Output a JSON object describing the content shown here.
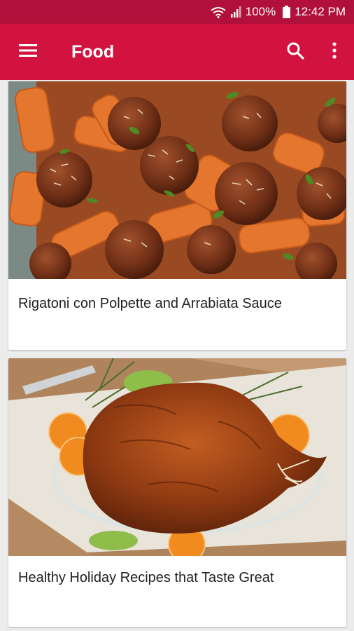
{
  "status_bar": {
    "battery": "100%",
    "time": "12:42 PM",
    "icons": [
      "wifi-icon",
      "signal-icon",
      "battery-icon"
    ]
  },
  "app_bar": {
    "title": "Food",
    "icons": [
      "menu-icon",
      "search-icon",
      "more-vert-icon"
    ]
  },
  "colors": {
    "status_bar": "#b01039",
    "app_bar": "#d3133f",
    "background": "#ececec"
  },
  "cards": [
    {
      "title": "Rigatoni con Polpette and Arrabiata Sauce"
    },
    {
      "title": "Healthy Holiday Recipes that Taste Great"
    }
  ]
}
